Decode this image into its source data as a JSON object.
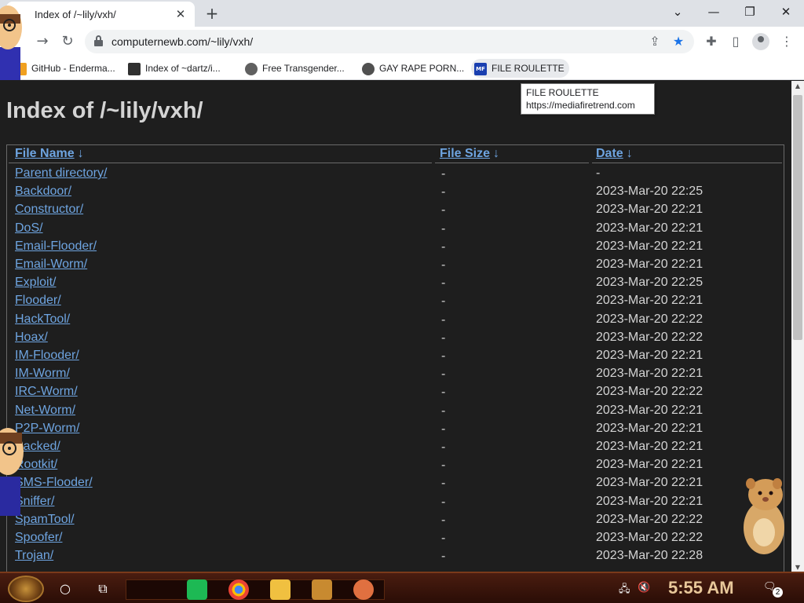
{
  "browser": {
    "tab_title": "Index of /~lily/vxh/",
    "close_tab_glyph": "✕",
    "new_tab_glyph": "+",
    "url": "computernewb.com/~lily/vxh/",
    "window_controls": {
      "dropdown": "⌄",
      "minimize": "—",
      "restore": "❐",
      "close": "✕"
    },
    "nav": {
      "back": "←",
      "forward": "→",
      "reload": "↻"
    },
    "toolbar_icons": {
      "share": "⇪",
      "star": "★",
      "extensions": "✚",
      "side_panel": "▯",
      "menu": "⋮"
    }
  },
  "bookmarks": [
    {
      "label": "GitHub - Enderma...",
      "favicon_color": "#f0a020"
    },
    {
      "label": "Index of ~dartz/i...",
      "favicon_color": "#303030"
    },
    {
      "label": "Free Transgender...",
      "favicon_color": "#606060"
    },
    {
      "label": "GAY RAPE PORN...",
      "favicon_color": "#505050"
    },
    {
      "label": "FILE ROULETTE",
      "favicon_color": "#1a3fb0",
      "favicon_text": "MF"
    }
  ],
  "tooltip": {
    "title": "FILE ROULETTE",
    "url": "https://mediafiretrend.com"
  },
  "page": {
    "title": "Index of /~lily/vxh/",
    "columns": {
      "name": "File Name",
      "size": "File Size",
      "date": "Date",
      "sort_glyph": "↓"
    },
    "rows": [
      {
        "name": "Parent directory/",
        "size": "-",
        "date": "-"
      },
      {
        "name": "Backdoor/",
        "size": "-",
        "date": "2023-Mar-20 22:25"
      },
      {
        "name": "Constructor/",
        "size": "-",
        "date": "2023-Mar-20 22:21"
      },
      {
        "name": "DoS/",
        "size": "-",
        "date": "2023-Mar-20 22:21"
      },
      {
        "name": "Email-Flooder/",
        "size": "-",
        "date": "2023-Mar-20 22:21"
      },
      {
        "name": "Email-Worm/",
        "size": "-",
        "date": "2023-Mar-20 22:21"
      },
      {
        "name": "Exploit/",
        "size": "-",
        "date": "2023-Mar-20 22:25"
      },
      {
        "name": "Flooder/",
        "size": "-",
        "date": "2023-Mar-20 22:21"
      },
      {
        "name": "HackTool/",
        "size": "-",
        "date": "2023-Mar-20 22:22"
      },
      {
        "name": "Hoax/",
        "size": "-",
        "date": "2023-Mar-20 22:22"
      },
      {
        "name": "IM-Flooder/",
        "size": "-",
        "date": "2023-Mar-20 22:21"
      },
      {
        "name": "IM-Worm/",
        "size": "-",
        "date": "2023-Mar-20 22:21"
      },
      {
        "name": "IRC-Worm/",
        "size": "-",
        "date": "2023-Mar-20 22:22"
      },
      {
        "name": "Net-Worm/",
        "size": "-",
        "date": "2023-Mar-20 22:21"
      },
      {
        "name": "P2P-Worm/",
        "size": "-",
        "date": "2023-Mar-20 22:21"
      },
      {
        "name": "Packed/",
        "size": "-",
        "date": "2023-Mar-20 22:21"
      },
      {
        "name": "Rootkit/",
        "size": "-",
        "date": "2023-Mar-20 22:21"
      },
      {
        "name": "SMS-Flooder/",
        "size": "-",
        "date": "2023-Mar-20 22:21"
      },
      {
        "name": "Sniffer/",
        "size": "-",
        "date": "2023-Mar-20 22:21"
      },
      {
        "name": "SpamTool/",
        "size": "-",
        "date": "2023-Mar-20 22:22"
      },
      {
        "name": "Spoofer/",
        "size": "-",
        "date": "2023-Mar-20 22:22"
      },
      {
        "name": "Trojan/",
        "size": "-",
        "date": "2023-Mar-20 22:28"
      }
    ]
  },
  "taskbar": {
    "clock": "5:55 AM",
    "notification_count": "2",
    "search_glyph": "○",
    "taskview_glyph": "⧉",
    "speaker_glyph": "🔇",
    "network_glyph": "🖧",
    "notification_glyph": "🗨"
  },
  "colors": {
    "link": "#6ea4e0",
    "page_bg": "#1e1e1e",
    "text": "#d4d4d4",
    "taskbar": "#3a140a",
    "clock": "#e8c89a"
  }
}
